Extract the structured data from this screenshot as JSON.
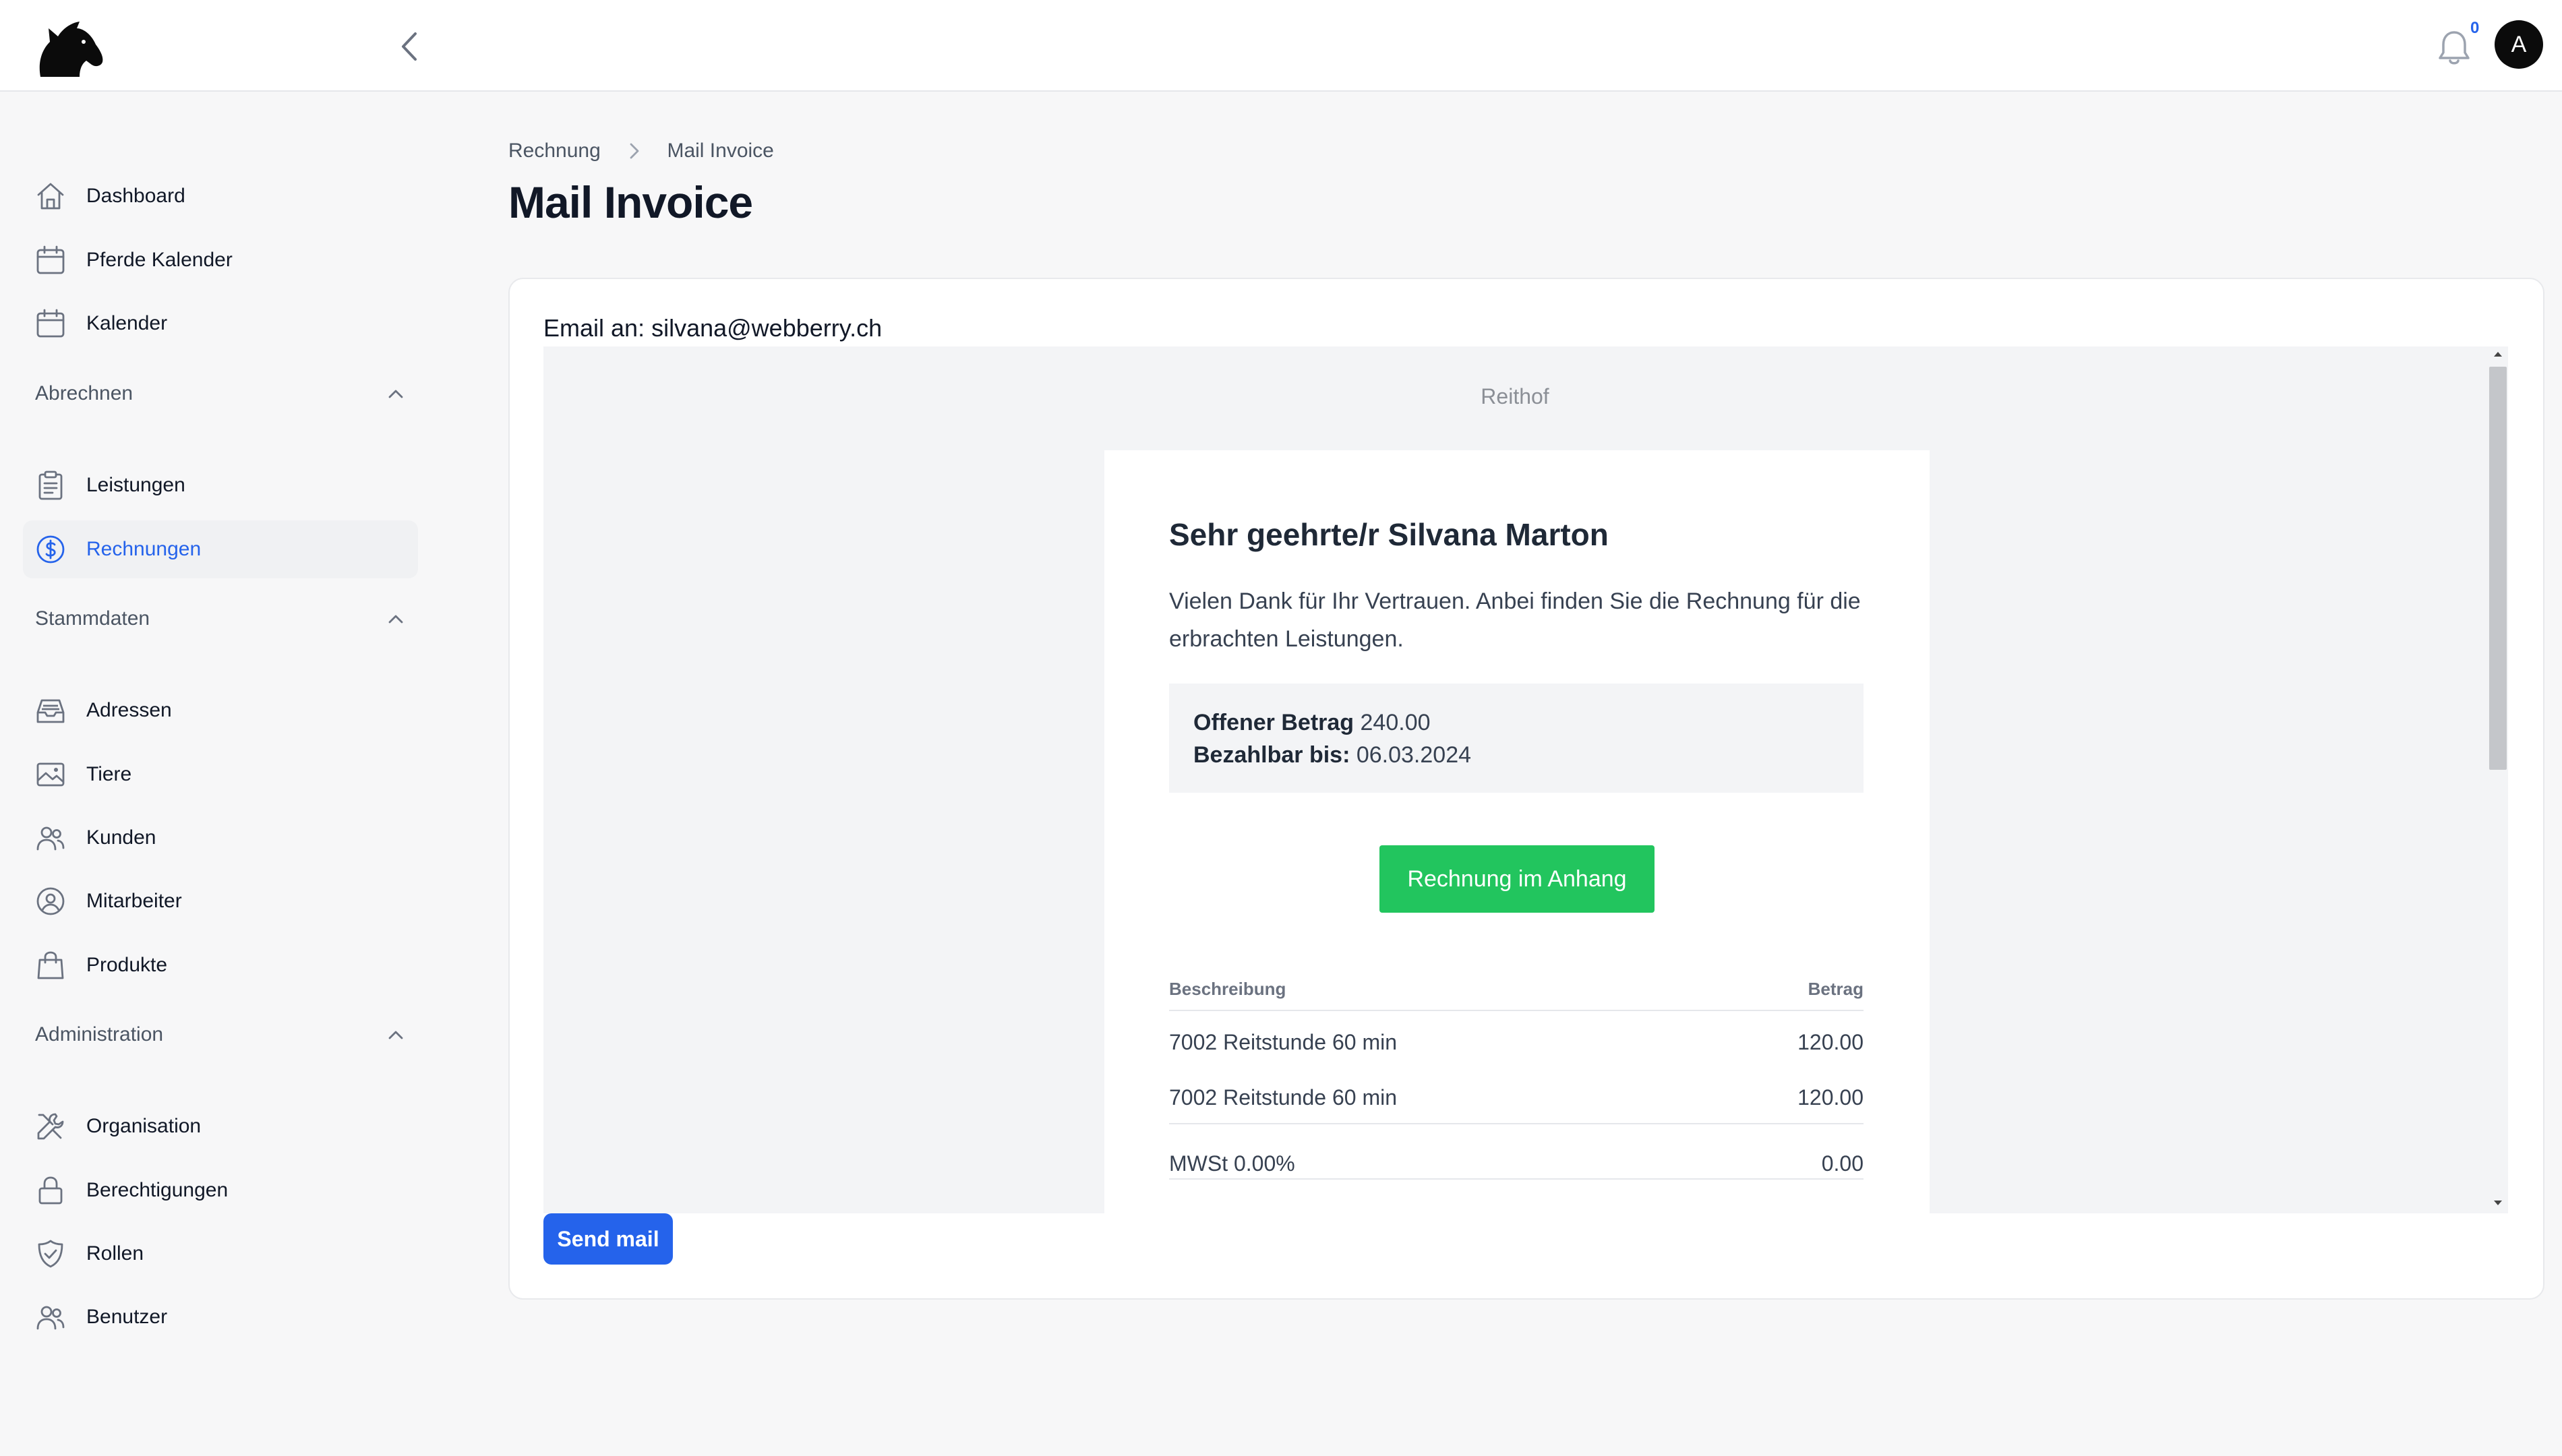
{
  "header": {
    "logo_icon": "horse-head-logo-icon",
    "collapse_icon": "chevron-left-icon",
    "notifications": {
      "icon": "bell-icon",
      "count": "0"
    },
    "avatar_initial": "A"
  },
  "sidebar": {
    "top_items": [
      {
        "label": "Dashboard",
        "icon": "home-icon"
      },
      {
        "label": "Pferde Kalender",
        "icon": "calendar-icon"
      },
      {
        "label": "Kalender",
        "icon": "calendar-icon"
      }
    ],
    "sections": [
      {
        "title": "Abrechnen",
        "items": [
          {
            "label": "Leistungen",
            "icon": "clipboard-icon"
          },
          {
            "label": "Rechnungen",
            "icon": "dollar-circle-icon",
            "active": true
          }
        ]
      },
      {
        "title": "Stammdaten",
        "items": [
          {
            "label": "Adressen",
            "icon": "inbox-icon"
          },
          {
            "label": "Tiere",
            "icon": "image-icon"
          },
          {
            "label": "Kunden",
            "icon": "users-icon"
          },
          {
            "label": "Mitarbeiter",
            "icon": "user-circle-icon"
          },
          {
            "label": "Produkte",
            "icon": "shopping-bag-icon"
          }
        ]
      },
      {
        "title": "Administration",
        "items": [
          {
            "label": "Organisation",
            "icon": "wrench-screwdriver-icon"
          },
          {
            "label": "Berechtigungen",
            "icon": "lock-icon"
          },
          {
            "label": "Rollen",
            "icon": "shield-check-icon"
          },
          {
            "label": "Benutzer",
            "icon": "users-icon"
          }
        ]
      }
    ]
  },
  "breadcrumb": {
    "parent": "Rechnung",
    "current": "Mail Invoice"
  },
  "page_title": "Mail Invoice",
  "email": {
    "to_label": "Email an:",
    "to_address": "silvana@webberry.ch",
    "preview": {
      "brand": "Reithof",
      "greeting": "Sehr geehrte/r Silvana Marton",
      "intro": "Vielen Dank für Ihr Vertrauen. Anbei finden Sie die Rechnung für die erbrachten Leistungen.",
      "open_amount_label": "Offener Betrag",
      "open_amount": "240.00",
      "due_label": "Bezahlbar bis:",
      "due_date": "06.03.2024",
      "cta_label": "Rechnung im Anhang",
      "cta_color": "#22c55e",
      "table": {
        "col_description": "Beschreibung",
        "col_amount": "Betrag",
        "rows": [
          {
            "description": "7002 Reitstunde 60 min",
            "amount": "120.00"
          },
          {
            "description": "7002 Reitstunde 60 min",
            "amount": "120.00"
          }
        ],
        "tax": {
          "label": "MWSt 0.00%",
          "amount": "0.00"
        }
      }
    }
  },
  "send_button_label": "Send mail",
  "colors": {
    "accent": "#2563eb",
    "success": "#22c55e"
  }
}
